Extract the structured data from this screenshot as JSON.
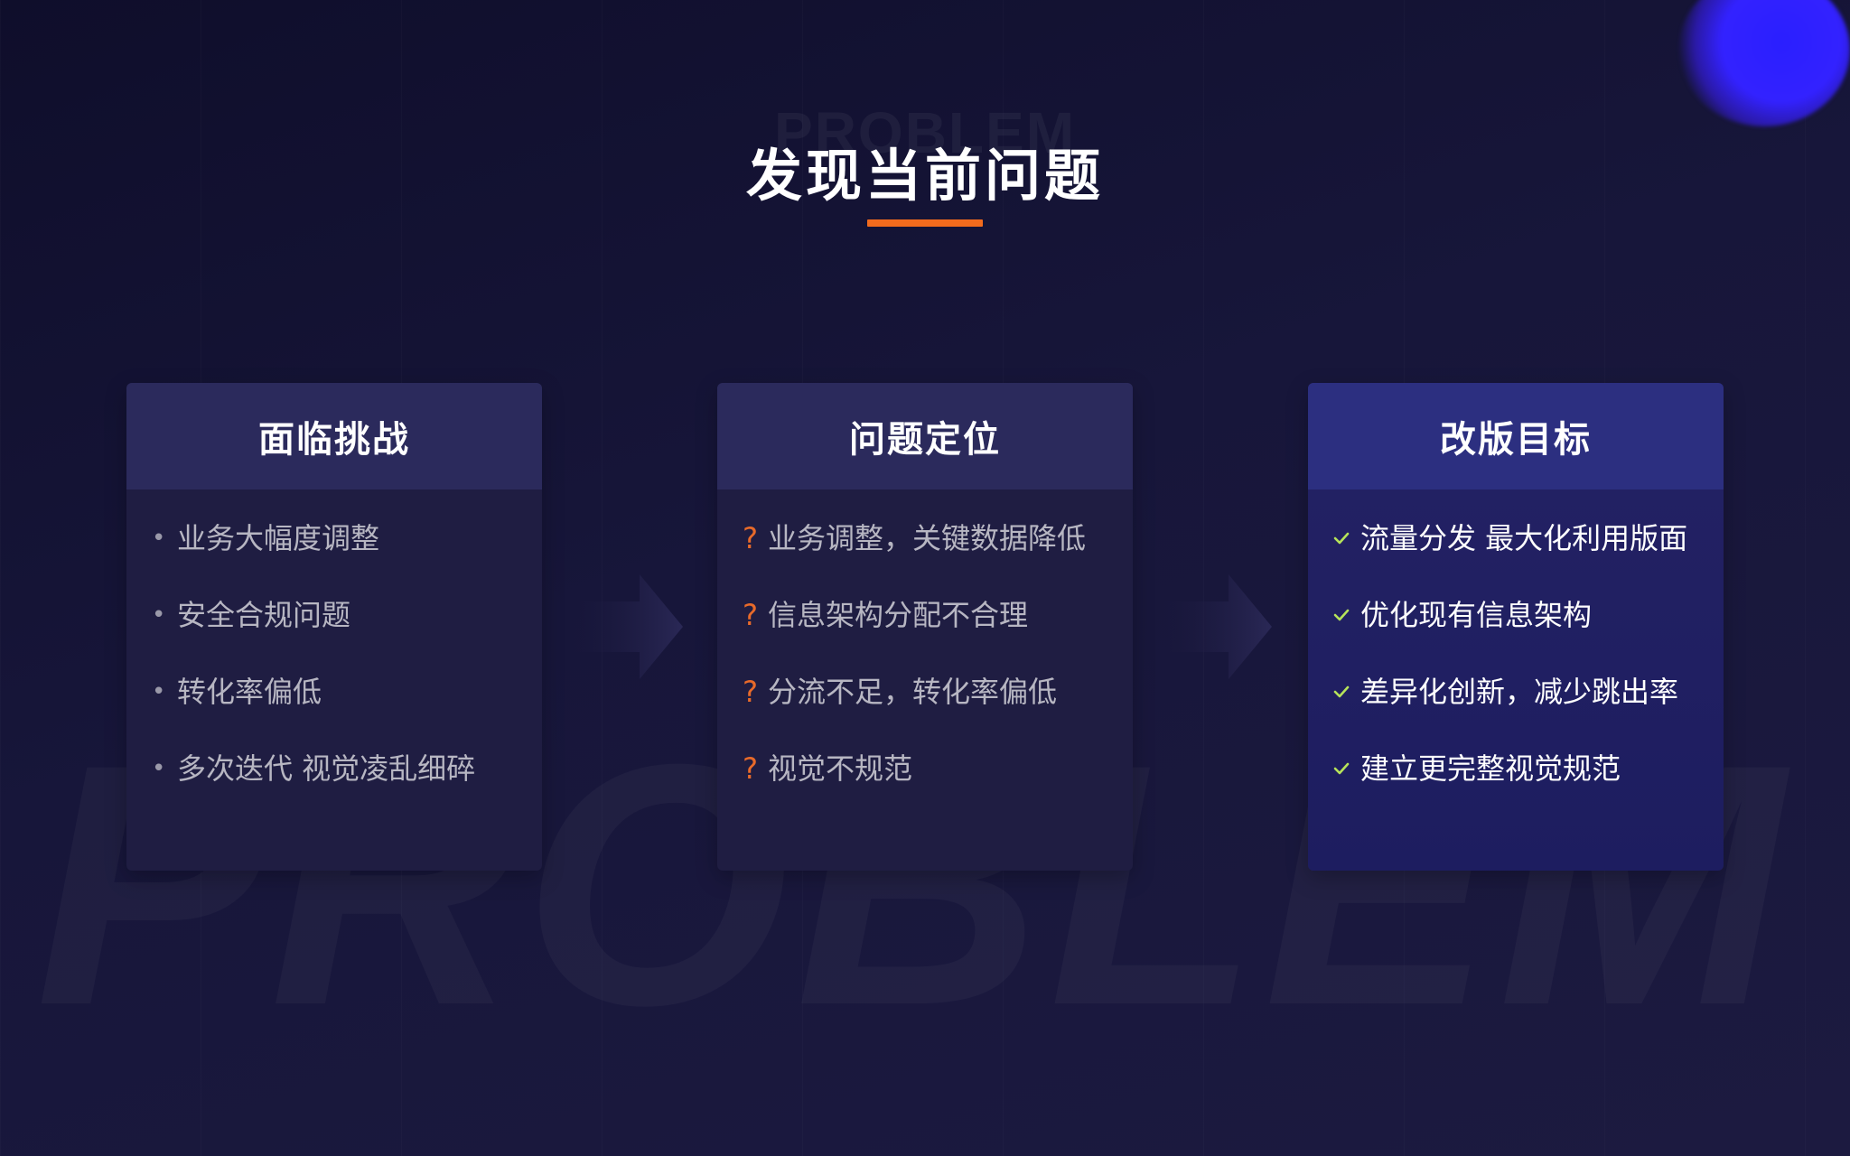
{
  "background_word": "PROBLEM",
  "header": {
    "watermark": "PROBLEM",
    "title": "发现当前问题",
    "accent": "#f26b1d"
  },
  "cards": [
    {
      "title": "面临挑战",
      "marker": "•",
      "marker_icon": "bullet-dot-icon",
      "items": [
        "业务大幅度调整",
        "安全合规问题",
        "转化率偏低",
        "多次迭代 视觉凌乱细碎"
      ]
    },
    {
      "title": "问题定位",
      "marker": "?",
      "marker_icon": "question-mark-icon",
      "marker_color": "#e86a2a",
      "items": [
        "业务调整，关键数据降低",
        "信息架构分配不合理",
        "分流不足，转化率偏低",
        "视觉不规范"
      ]
    },
    {
      "title": "改版目标",
      "marker_icon": "checkmark-icon",
      "marker_color": "#b6e35a",
      "items": [
        "流量分发 最大化利用版面",
        "优化现有信息架构",
        "差异化创新，减少跳出率",
        "建立更完整视觉规范"
      ]
    }
  ],
  "arrows": [
    "arrow-right-icon",
    "arrow-right-icon"
  ]
}
